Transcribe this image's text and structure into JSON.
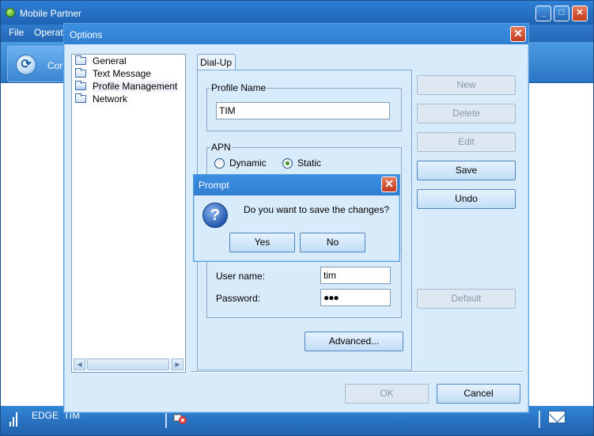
{
  "app": {
    "title": "Mobile Partner",
    "menu": [
      "File",
      "Operati"
    ],
    "toolbar_connect_label": "Cor",
    "status": {
      "network": "EDGE",
      "operator": "TIM"
    }
  },
  "options": {
    "title": "Options",
    "tree": [
      {
        "label": "General",
        "selected": false
      },
      {
        "label": "Text Message",
        "selected": false
      },
      {
        "label": "Profile Management",
        "selected": true
      },
      {
        "label": "Network",
        "selected": false
      }
    ],
    "tab_label": "Dial-Up",
    "profile_name": {
      "title": "Profile Name",
      "value": "TIM"
    },
    "apn": {
      "title": "APN",
      "dynamic_label": "Dynamic",
      "static_label": "Static",
      "selected": "Static"
    },
    "user_name": {
      "label": "User name:",
      "value": "tim"
    },
    "password": {
      "label": "Password:",
      "value": "●●●"
    },
    "advanced_label": "Advanced...",
    "side_buttons": {
      "new": "New",
      "delete": "Delete",
      "edit": "Edit",
      "save": "Save",
      "undo": "Undo",
      "default": "Default"
    },
    "ok_label": "OK",
    "cancel_label": "Cancel"
  },
  "prompt": {
    "title": "Prompt",
    "message": "Do you want to save the changes?",
    "yes_label": "Yes",
    "no_label": "No"
  }
}
